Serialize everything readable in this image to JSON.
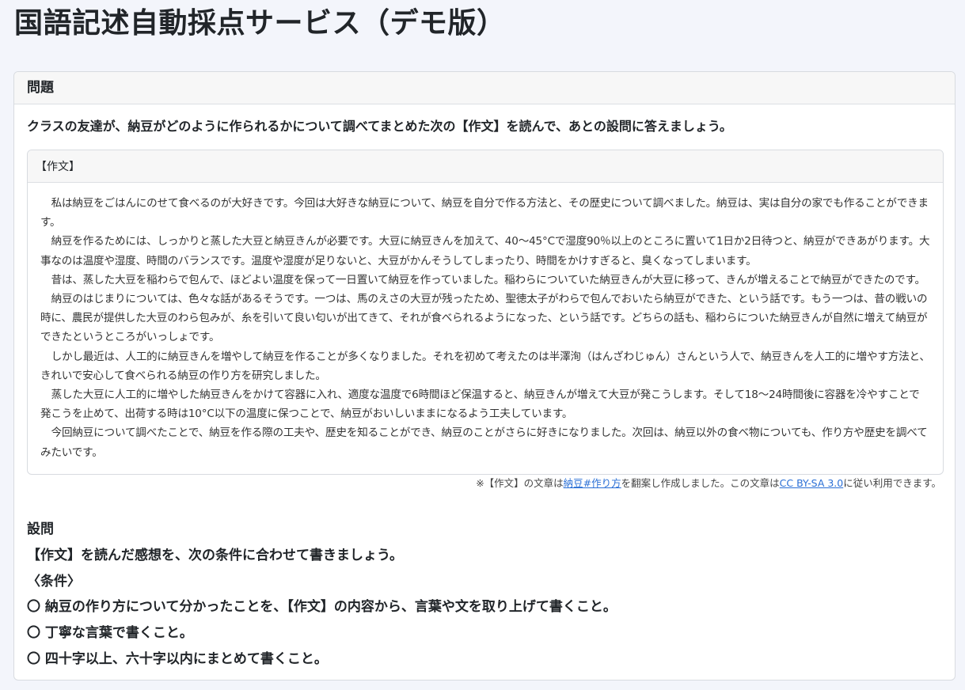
{
  "page": {
    "title": "国語記述自動採点サービス（デモ版）"
  },
  "problem": {
    "header": "問題",
    "question": "クラスの友達が、納豆がどのように作られるかについて調べてまとめた次の【作文】を読んで、あとの設問に答えましょう。",
    "essay": {
      "header": "【作文】",
      "paragraphs": [
        "私は納豆をごはんにのせて食べるのが大好きです。今回は大好きな納豆について、納豆を自分で作る方法と、その歴史について調べました。納豆は、実は自分の家でも作ることができます。",
        "納豆を作るためには、しっかりと蒸した大豆と納豆きんが必要です。大豆に納豆きんを加えて、40〜45°Cで湿度90％以上のところに置いて1日か2日待つと、納豆ができあがります。大事なのは温度や湿度、時間のバランスです。温度や湿度が足りないと、大豆がかんそうしてしまったり、時間をかけすぎると、臭くなってしまいます。",
        "昔は、蒸した大豆を稲わらで包んで、ほどよい温度を保って一日置いて納豆を作っていました。稲わらについていた納豆きんが大豆に移って、きんが増えることで納豆ができたのです。",
        "納豆のはじまりについては、色々な話があるそうです。一つは、馬のえさの大豆が残ったため、聖徳太子がわらで包んでおいたら納豆ができた、という話です。もう一つは、昔の戦いの時に、農民が提供した大豆のわら包みが、糸を引いて良い匂いが出てきて、それが食べられるようになった、という話です。どちらの話も、稲わらについた納豆きんが自然に増えて納豆ができたというところがいっしょです。",
        "しかし最近は、人工的に納豆きんを増やして納豆を作ることが多くなりました。それを初めて考えたのは半澤洵（はんざわじゅん）さんという人で、納豆きんを人工的に増やす方法と、きれいで安心して食べられる納豆の作り方を研究しました。",
        "蒸した大豆に人工的に増やした納豆きんをかけて容器に入れ、適度な温度で6時間ほど保温すると、納豆きんが増えて大豆が発こうします。そして18〜24時間後に容器を冷やすことで発こうを止めて、出荷する時は10°C以下の温度に保つことで、納豆がおいしいままになるよう工夫しています。",
        "今回納豆について調べたことで、納豆を作る際の工夫や、歴史を知ることができ、納豆のことがさらに好きになりました。次回は、納豆以外の食べ物についても、作り方や歴史を調べてみたいです。"
      ]
    },
    "attribution": {
      "prefix": "※【作文】の文章は",
      "link1_text": "納豆#作り方",
      "middle": "を翻案し作成しました。この文章は",
      "link2_text": "CC BY-SA 3.0",
      "suffix": "に従い利用できます。"
    },
    "prompt": {
      "heading": "設問",
      "instruction": "【作文】を読んだ感想を、次の条件に合わせて書きましょう。",
      "conditions_label": "〈条件〉",
      "conditions": [
        "〇 納豆の作り方について分かったことを、【作文】の内容から、言葉や文を取り上げて書くこと。",
        "〇 丁寧な言葉で書くこと。",
        "〇 四十字以上、六十字以内にまとめて書くこと。"
      ]
    }
  }
}
